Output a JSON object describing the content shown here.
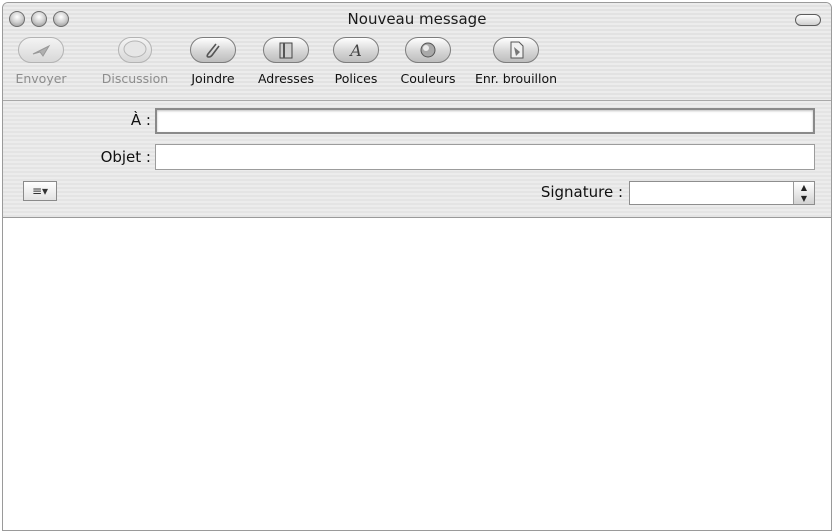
{
  "window": {
    "title": "Nouveau message"
  },
  "toolbar": {
    "items": [
      {
        "label": "Envoyer",
        "icon": "send-icon",
        "enabled": false
      },
      {
        "label": "Discussion",
        "icon": "chat-bubble-icon",
        "enabled": false
      },
      {
        "label": "Joindre",
        "icon": "paperclip-icon",
        "enabled": true
      },
      {
        "label": "Adresses",
        "icon": "address-book-icon",
        "enabled": true
      },
      {
        "label": "Polices",
        "icon": "font-icon",
        "enabled": true
      },
      {
        "label": "Couleurs",
        "icon": "color-wheel-icon",
        "enabled": true
      },
      {
        "label": "Enr. brouillon",
        "icon": "save-draft-icon",
        "enabled": true
      }
    ]
  },
  "headers": {
    "to_label": "À :",
    "to_value": "",
    "subject_label": "Objet :",
    "subject_value": "",
    "format_button": "≡▾",
    "signature_label": "Signature :",
    "signature_value": ""
  },
  "message": {
    "body": ""
  }
}
